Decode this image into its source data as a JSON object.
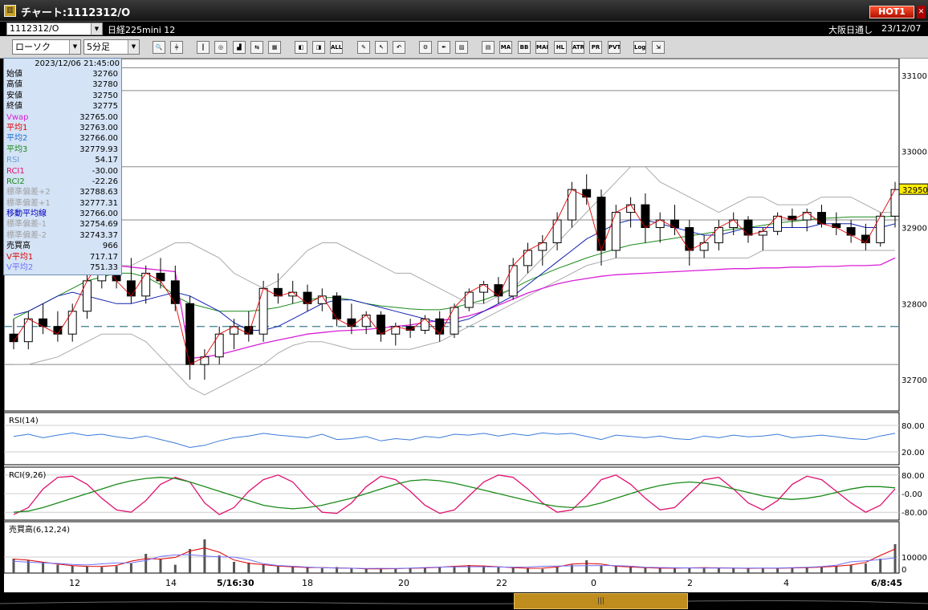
{
  "window": {
    "title": "チャート:1112312/O",
    "hot_badge": "HOT1",
    "close_glyph": "✕",
    "icon_glyph": "▥"
  },
  "symbol_bar": {
    "code": "1112312/O",
    "name": "日経225mini 12",
    "market": "大阪日通し",
    "date": "23/12/07"
  },
  "toolbar": {
    "chart_type": "ローソク",
    "interval": "5分足",
    "tools": [
      {
        "name": "zoom-icon",
        "glyph": "🔍"
      },
      {
        "name": "crosshair-icon",
        "glyph": "╪"
      },
      {
        "name": "candle-icon",
        "glyph": "┃"
      },
      {
        "name": "cycle-icon",
        "glyph": "◎"
      },
      {
        "name": "chart-icon",
        "glyph": "▟"
      },
      {
        "name": "arrows-icon",
        "glyph": "⇆"
      },
      {
        "name": "disabled-icon",
        "glyph": "▦"
      },
      {
        "name": "compare-icon",
        "glyph": "◧"
      },
      {
        "name": "split-icon",
        "glyph": "◨"
      },
      {
        "name": "all-icon",
        "glyph": "ALL"
      },
      {
        "name": "pen-icon",
        "glyph": "✎"
      },
      {
        "name": "cursor-icon",
        "glyph": "↖"
      },
      {
        "name": "undo-icon",
        "glyph": "↶"
      },
      {
        "name": "gear-icon",
        "glyph": "⚙"
      },
      {
        "name": "wrench-icon",
        "glyph": "✒"
      },
      {
        "name": "palette-icon",
        "glyph": "▧"
      },
      {
        "name": "table-icon",
        "glyph": "▤"
      },
      {
        "name": "ma-icon",
        "glyph": "MA"
      },
      {
        "name": "bb-icon",
        "glyph": "BB"
      },
      {
        "name": "mae-icon",
        "glyph": "MAE"
      },
      {
        "name": "hl-icon",
        "glyph": "HL"
      },
      {
        "name": "atr-icon",
        "glyph": "ATR"
      },
      {
        "name": "pr-icon",
        "glyph": "PR"
      },
      {
        "name": "pvt-icon",
        "glyph": "PVT"
      },
      {
        "name": "log-icon",
        "glyph": "Log"
      },
      {
        "name": "export-icon",
        "glyph": "⇲"
      }
    ]
  },
  "info_panel": {
    "datetime": "2023/12/06 21:45:00",
    "rows": [
      {
        "label": "始値",
        "value": "32760",
        "color": "#000000"
      },
      {
        "label": "高値",
        "value": "32780",
        "color": "#000000"
      },
      {
        "label": "安値",
        "value": "32750",
        "color": "#000000"
      },
      {
        "label": "終値",
        "value": "32775",
        "color": "#000000"
      },
      {
        "label": "Vwap",
        "value": "32765.00",
        "color": "#d81fd8"
      },
      {
        "label": "平均1",
        "value": "32763.00",
        "color": "#e00000"
      },
      {
        "label": "平均2",
        "value": "32766.00",
        "color": "#1e6fd0"
      },
      {
        "label": "平均3",
        "value": "32779.93",
        "color": "#1a8a1a"
      },
      {
        "label": "RSI",
        "value": "54.17",
        "color": "#6b9bd8"
      },
      {
        "label": "RCI1",
        "value": "-30.00",
        "color": "#e01070"
      },
      {
        "label": "RCI2",
        "value": "-22.26",
        "color": "#1a8a1a"
      },
      {
        "label": "標準偏差+2",
        "value": "32788.63",
        "color": "#a0a0a0"
      },
      {
        "label": "標準偏差+1",
        "value": "32777.31",
        "color": "#a0a0a0"
      },
      {
        "label": "移動平均線",
        "value": "32766.00",
        "color": "#0000c0"
      },
      {
        "label": "標準偏差-1",
        "value": "32754.69",
        "color": "#a0a0a0"
      },
      {
        "label": "標準偏差-2",
        "value": "32743.37",
        "color": "#a0a0a0"
      },
      {
        "label": "売買高",
        "value": "966",
        "color": "#000000"
      },
      {
        "label": "V平均1",
        "value": "717.17",
        "color": "#e00000"
      },
      {
        "label": "V平均2",
        "value": "751.33",
        "color": "#7070ff"
      }
    ]
  },
  "chart_data": {
    "type": "candlestick",
    "y_ticks": [
      32700,
      32800,
      32900,
      33000,
      33100
    ],
    "y_range": [
      32660,
      33120
    ],
    "last_price": 32950,
    "x_ticks": [
      "12",
      "14",
      "5/16:30",
      "18",
      "20",
      "22",
      "0",
      "2",
      "4",
      "6/8:45"
    ],
    "series": {
      "bb_upper": [
        32850,
        32860,
        32870,
        32875,
        32870,
        32860,
        32855,
        32850,
        32850,
        32860,
        32870,
        32880,
        32880,
        32870,
        32860,
        32840,
        32830,
        32820,
        32830,
        32850,
        32870,
        32880,
        32880,
        32870,
        32860,
        32850,
        32840,
        32840,
        32830,
        32820,
        32810,
        32800,
        32800,
        32810,
        32820,
        32840,
        32860,
        32880,
        32900,
        32920,
        32940,
        32960,
        32980,
        32980,
        32960,
        32950,
        32940,
        32930,
        32920,
        32930,
        32940,
        32940,
        32930,
        32930,
        32930,
        32940,
        32940,
        32940,
        32930,
        32920,
        32920
      ],
      "bb_lower": [
        32720,
        32720,
        32725,
        32730,
        32740,
        32750,
        32760,
        32760,
        32760,
        32750,
        32730,
        32710,
        32690,
        32680,
        32690,
        32700,
        32710,
        32720,
        32735,
        32745,
        32750,
        32750,
        32745,
        32740,
        32740,
        32740,
        32740,
        32740,
        32745,
        32750,
        32760,
        32770,
        32780,
        32790,
        32800,
        32810,
        32820,
        32830,
        32840,
        32850,
        32855,
        32860,
        32860,
        32860,
        32860,
        32860,
        32860,
        32860,
        32860,
        32860,
        32860,
        32870,
        32870,
        32870,
        32870,
        32870,
        32870,
        32870,
        32870,
        32870,
        32870
      ],
      "ma": [
        32785,
        32790,
        32800,
        32810,
        32815,
        32810,
        32805,
        32800,
        32800,
        32805,
        32810,
        32815,
        32810,
        32800,
        32790,
        32775,
        32765,
        32765,
        32770,
        32780,
        32790,
        32800,
        32805,
        32805,
        32800,
        32795,
        32790,
        32785,
        32780,
        32775,
        32775,
        32780,
        32790,
        32800,
        32810,
        32825,
        32840,
        32855,
        32870,
        32885,
        32895,
        32905,
        32910,
        32910,
        32905,
        32900,
        32895,
        32890,
        32890,
        32895,
        32900,
        32900,
        32900,
        32900,
        32900,
        32905,
        32905,
        32905,
        32900,
        32900,
        32905
      ],
      "ma_long": [
        32780,
        32790,
        32800,
        32810,
        32820,
        32830,
        32835,
        32840,
        32840,
        32835,
        32825,
        32810,
        32800,
        32795,
        32790,
        32790,
        32790,
        32792,
        32795,
        32800,
        32805,
        32808,
        32808,
        32805,
        32800,
        32797,
        32795,
        32793,
        32792,
        32792,
        32795,
        32800,
        32805,
        32812,
        32820,
        32830,
        32838,
        32846,
        32853,
        32860,
        32866,
        32872,
        32877,
        32880,
        32883,
        32886,
        32889,
        32892,
        32895,
        32898,
        32900,
        32903,
        32906,
        32908,
        32910,
        32912,
        32913,
        32914,
        32914,
        32914,
        32915
      ],
      "vwap": [
        32860,
        32860,
        32860,
        32858,
        32856,
        32854,
        32852,
        32850,
        32848,
        32846,
        32844,
        32842,
        32728,
        32730,
        32733,
        32738,
        32743,
        32748,
        32752,
        32756,
        32760,
        32762,
        32764,
        32765,
        32766,
        32768,
        32770,
        32772,
        32775,
        32778,
        32780,
        32784,
        32790,
        32798,
        32806,
        32814,
        32820,
        32826,
        32830,
        32833,
        32836,
        32838,
        32839,
        32840,
        32841,
        32842,
        32843,
        32844,
        32845,
        32846,
        32846,
        32847,
        32847,
        32848,
        32848,
        32849,
        32849,
        32850,
        32850,
        32851,
        32860
      ],
      "candles": [
        [
          32760,
          32780,
          32740,
          32750
        ],
        [
          32750,
          32790,
          32740,
          32780
        ],
        [
          32780,
          32800,
          32760,
          32770
        ],
        [
          32770,
          32790,
          32750,
          32760
        ],
        [
          32760,
          32800,
          32750,
          32790
        ],
        [
          32790,
          32840,
          32780,
          32830
        ],
        [
          32830,
          32880,
          32820,
          32860
        ],
        [
          32860,
          32870,
          32820,
          32830
        ],
        [
          32830,
          32860,
          32800,
          32810
        ],
        [
          32810,
          32850,
          32800,
          32840
        ],
        [
          32840,
          32860,
          32820,
          32830
        ],
        [
          32830,
          32850,
          32790,
          32800
        ],
        [
          32800,
          32810,
          32700,
          32720
        ],
        [
          32720,
          32740,
          32700,
          32730
        ],
        [
          32730,
          32770,
          32720,
          32760
        ],
        [
          32760,
          32780,
          32740,
          32770
        ],
        [
          32770,
          32790,
          32750,
          32760
        ],
        [
          32760,
          32830,
          32750,
          32820
        ],
        [
          32820,
          32840,
          32800,
          32810
        ],
        [
          32810,
          32830,
          32800,
          32815
        ],
        [
          32815,
          32825,
          32790,
          32800
        ],
        [
          32800,
          32820,
          32790,
          32810
        ],
        [
          32810,
          32815,
          32770,
          32780
        ],
        [
          32780,
          32800,
          32760,
          32770
        ],
        [
          32770,
          32790,
          32760,
          32785
        ],
        [
          32785,
          32790,
          32750,
          32760
        ],
        [
          32760,
          32775,
          32745,
          32770
        ],
        [
          32770,
          32780,
          32755,
          32765
        ],
        [
          32765,
          32785,
          32760,
          32780
        ],
        [
          32780,
          32790,
          32750,
          32760
        ],
        [
          32760,
          32800,
          32755,
          32795
        ],
        [
          32795,
          32820,
          32790,
          32815
        ],
        [
          32815,
          32830,
          32800,
          32825
        ],
        [
          32825,
          32835,
          32800,
          32810
        ],
        [
          32810,
          32860,
          32805,
          32850
        ],
        [
          32850,
          32880,
          32840,
          32870
        ],
        [
          32870,
          32890,
          32850,
          32880
        ],
        [
          32880,
          32920,
          32870,
          32910
        ],
        [
          32910,
          32960,
          32900,
          32950
        ],
        [
          32950,
          32970,
          32930,
          32940
        ],
        [
          32940,
          32950,
          32850,
          32870
        ],
        [
          32870,
          32930,
          32860,
          32920
        ],
        [
          32920,
          32940,
          32900,
          32930
        ],
        [
          32930,
          32945,
          32880,
          32900
        ],
        [
          32900,
          32920,
          32880,
          32910
        ],
        [
          32910,
          32930,
          32890,
          32900
        ],
        [
          32900,
          32910,
          32850,
          32870
        ],
        [
          32870,
          32890,
          32860,
          32880
        ],
        [
          32880,
          32910,
          32870,
          32900
        ],
        [
          32900,
          32920,
          32890,
          32910
        ],
        [
          32910,
          32915,
          32880,
          32890
        ],
        [
          32890,
          32900,
          32870,
          32895
        ],
        [
          32895,
          32920,
          32890,
          32915
        ],
        [
          32915,
          32925,
          32900,
          32910
        ],
        [
          32910,
          32925,
          32895,
          32920
        ],
        [
          32920,
          32930,
          32900,
          32905
        ],
        [
          32905,
          32920,
          32890,
          32900
        ],
        [
          32900,
          32910,
          32880,
          32890
        ],
        [
          32890,
          32905,
          32870,
          32880
        ],
        [
          32880,
          32920,
          32875,
          32915
        ],
        [
          32915,
          32960,
          32900,
          32950
        ]
      ],
      "rsi": [
        55,
        60,
        52,
        58,
        63,
        57,
        60,
        54,
        50,
        56,
        48,
        40,
        30,
        35,
        45,
        52,
        56,
        62,
        58,
        55,
        52,
        60,
        48,
        50,
        55,
        45,
        50,
        47,
        55,
        52,
        60,
        58,
        62,
        56,
        61,
        57,
        63,
        60,
        62,
        55,
        48,
        58,
        55,
        52,
        56,
        50,
        48,
        56,
        52,
        58,
        54,
        56,
        60,
        52,
        55,
        58,
        54,
        50,
        48,
        56,
        62
      ],
      "rci1": [
        -90,
        -60,
        20,
        70,
        75,
        40,
        -20,
        -70,
        -80,
        -30,
        40,
        70,
        50,
        -40,
        -90,
        -60,
        10,
        60,
        80,
        50,
        -20,
        -80,
        -85,
        -40,
        30,
        75,
        60,
        10,
        -50,
        -85,
        -70,
        -10,
        50,
        80,
        70,
        20,
        -40,
        -80,
        -70,
        -10,
        60,
        80,
        40,
        -20,
        -70,
        -60,
        0,
        60,
        70,
        20,
        -40,
        -70,
        -30,
        40,
        75,
        60,
        10,
        -40,
        -80,
        -50,
        20
      ],
      "rci2": [
        -80,
        -75,
        -60,
        -40,
        -20,
        0,
        20,
        40,
        55,
        65,
        70,
        65,
        50,
        30,
        10,
        -10,
        -30,
        -50,
        -60,
        -65,
        -60,
        -50,
        -35,
        -20,
        0,
        20,
        40,
        55,
        60,
        55,
        45,
        30,
        15,
        0,
        -15,
        -30,
        -45,
        -55,
        -60,
        -55,
        -40,
        -20,
        0,
        20,
        35,
        45,
        50,
        45,
        35,
        20,
        5,
        -10,
        -20,
        -25,
        -20,
        -10,
        5,
        20,
        30,
        30,
        25
      ],
      "volume": [
        900,
        820,
        700,
        520,
        460,
        420,
        380,
        440,
        600,
        1200,
        900,
        520,
        1500,
        2100,
        1100,
        700,
        650,
        500,
        420,
        380,
        350,
        300,
        380,
        280,
        260,
        240,
        300,
        280,
        320,
        360,
        420,
        500,
        460,
        380,
        340,
        300,
        260,
        360,
        520,
        800,
        480,
        420,
        380,
        340,
        300,
        280,
        330,
        360,
        320,
        300,
        310,
        280,
        320,
        300,
        340,
        360,
        420,
        500,
        600,
        900,
        1800
      ]
    }
  }
}
